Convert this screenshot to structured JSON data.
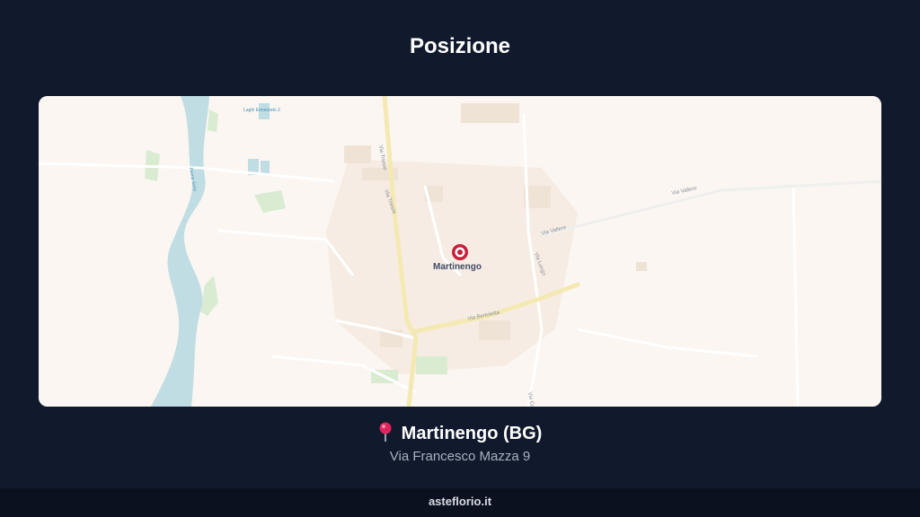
{
  "header": {
    "title": "Posizione"
  },
  "map": {
    "marker_label": "Martinengo",
    "street_labels": {
      "via_trieste_top": "Via Trieste",
      "via_trieste_mid": "Via Trieste",
      "via_vallere_east": "Via Vallere",
      "via_vallere_mid": "Via Vallere",
      "via_lungo": "Via Lungo",
      "via_bertoletta": "Via Bertoletta",
      "via_cortenuova": "Via Co",
      "lago": "Laghi Ermenodo 2",
      "fiume": "Fiume Serio"
    },
    "colors": {
      "land": "#fbf6f1",
      "water": "#bfdde3",
      "road_major": "#f4e9b3",
      "park": "#d9ecd2",
      "marker": "#c81e3c"
    }
  },
  "location": {
    "pin_icon": "round-pushpin-icon",
    "name": "Martinengo (BG)",
    "address": "Via Francesco Mazza 9"
  },
  "footer": {
    "site": "asteflorio.it"
  }
}
